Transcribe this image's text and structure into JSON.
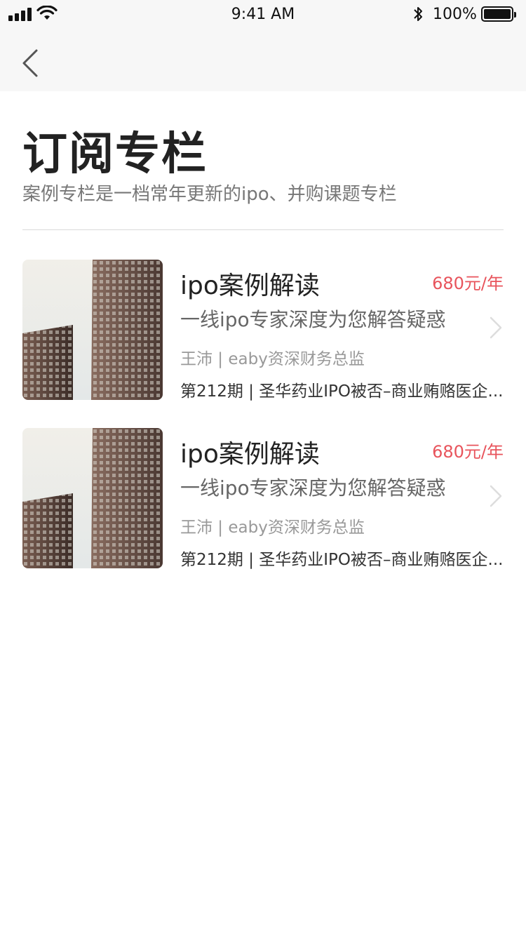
{
  "status_bar": {
    "time": "9:41 AM",
    "battery_pct": "100%",
    "icons": [
      "signal-icon",
      "wifi-icon",
      "bluetooth-icon",
      "battery-icon"
    ]
  },
  "nav": {
    "back_icon": "chevron-left-icon"
  },
  "header": {
    "title": "订阅专栏",
    "subtitle": "案例专栏是一档常年更新的ipo、并购课题专栏"
  },
  "colors": {
    "price": "#e8545c",
    "background": "#ffffff",
    "topbar": "#f7f7f7"
  },
  "columns": [
    {
      "title": "ipo案例解读",
      "price": "680元/年",
      "description": "一线ipo专家深度为您解答疑惑",
      "author": "王沛 | eaby资深财务总监",
      "latest_issue": "第212期 | 圣华药业IPO被否–商业贿赂医企..."
    },
    {
      "title": "ipo案例解读",
      "price": "680元/年",
      "description": "一线ipo专家深度为您解答疑惑",
      "author": "王沛 | eaby资深财务总监",
      "latest_issue": "第212期 | 圣华药业IPO被否–商业贿赂医企..."
    }
  ]
}
